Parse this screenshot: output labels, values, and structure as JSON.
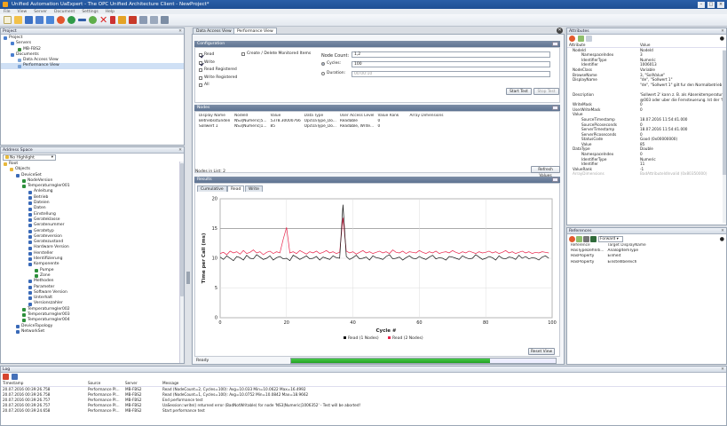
{
  "window": {
    "title": "Unified Automation UaExpert - The OPC Unified Architecture Client - NewProject*"
  },
  "menu": [
    "File",
    "View",
    "Server",
    "Document",
    "Settings",
    "Help"
  ],
  "project": {
    "header": "Project",
    "items": [
      {
        "label": "Project",
        "level": 0
      },
      {
        "label": "Servers",
        "level": 1
      },
      {
        "label": "MB-FBS2",
        "level": 2
      },
      {
        "label": "Documents",
        "level": 1
      },
      {
        "label": "Data Access View",
        "level": 2
      },
      {
        "label": "Performance View",
        "level": 2
      }
    ]
  },
  "address_space": {
    "header": "Address Space",
    "filter": "No Highlight",
    "items": [
      {
        "label": "Root",
        "level": 0
      },
      {
        "label": "Objects",
        "level": 1
      },
      {
        "label": "DeviceSet",
        "level": 2
      },
      {
        "label": "NodeVersion",
        "level": 3
      },
      {
        "label": "Temperaturregler001",
        "level": 3
      },
      {
        "label": "Anleitung",
        "level": 4
      },
      {
        "label": "Betrieb",
        "level": 4
      },
      {
        "label": "Dateien",
        "level": 4
      },
      {
        "label": "Daten",
        "level": 4
      },
      {
        "label": "Einstellung",
        "level": 4
      },
      {
        "label": "Gerateklasse",
        "level": 4
      },
      {
        "label": "Geratenummer",
        "level": 4
      },
      {
        "label": "Geratetyp",
        "level": 4
      },
      {
        "label": "Gerateversion",
        "level": 4
      },
      {
        "label": "Geratezustand",
        "level": 4
      },
      {
        "label": "Hardware Version",
        "level": 4
      },
      {
        "label": "Hersteller",
        "level": 4
      },
      {
        "label": "Identifizierung",
        "level": 4
      },
      {
        "label": "Komponente",
        "level": 4
      },
      {
        "label": "Pumpe",
        "level": 5
      },
      {
        "label": "Zone",
        "level": 5
      },
      {
        "label": "Methoden",
        "level": 4
      },
      {
        "label": "Parameter",
        "level": 4
      },
      {
        "label": "Software Version",
        "level": 4
      },
      {
        "label": "Unterhalt",
        "level": 4
      },
      {
        "label": "Versionszahler",
        "level": 4
      },
      {
        "label": "Temperaturregler002",
        "level": 3
      },
      {
        "label": "Temperaturregler003",
        "level": 3
      },
      {
        "label": "Temperaturregler004",
        "level": 3
      },
      {
        "label": "DeviceTopology",
        "level": 2
      },
      {
        "label": "NetworkSet",
        "level": 2
      }
    ]
  },
  "tabs": [
    "Data Access View",
    "Performance View"
  ],
  "configuration": {
    "title": "Configuration",
    "options": [
      {
        "label": "Read",
        "checked": true
      },
      {
        "label": "Write",
        "checked": true
      },
      {
        "label": "Read Registered",
        "checked": false
      },
      {
        "label": "Write Registered",
        "checked": false
      },
      {
        "label": "All",
        "checked": false
      }
    ],
    "create_delete_label": "Create / Delete Monitored Items",
    "node_count_label": "Node Count:",
    "node_count_value": "1,2",
    "cycles_label": "Cycles:",
    "cycles_value": "100",
    "duration_label": "Duration:",
    "duration_value": "00:00:10",
    "start_label": "Start Test",
    "stop_label": "Stop Test"
  },
  "nodes": {
    "title": "Nodes",
    "columns": [
      "Display Name",
      "NodeId",
      "Value",
      "Data Type",
      "User Access Level",
      "Value Rank",
      "Array Dimensions"
    ],
    "rows": [
      [
        "Betriebsstunden",
        "NS3|Numeric|5...",
        "5378.30000766",
        "OpcUaType_Do...",
        "Readable",
        "0",
        ""
      ],
      [
        "Sollwert 1",
        "NS3|Numeric|1...",
        "85",
        "OpcUaType_Do...",
        "Readable, Write...",
        "0",
        ""
      ]
    ],
    "nodes_in_list": "Nodes in List: 2",
    "refresh_label": "Refresh Values"
  },
  "results": {
    "title": "Results",
    "tabs": [
      "Cumulative",
      "Read",
      "Write"
    ],
    "reset_label": "Reset View",
    "status": "Ready",
    "progress": 1.0
  },
  "chart_data": {
    "type": "line",
    "xlabel": "Cycle #",
    "ylabel": "Time per Call (ms)",
    "xlim": [
      0,
      100
    ],
    "ylim": [
      0,
      20
    ],
    "xticks": [
      0,
      20,
      40,
      60,
      80,
      100
    ],
    "yticks": [
      0,
      5,
      10,
      15,
      20
    ],
    "grid": true,
    "legend": "bottom-center",
    "series": [
      {
        "name": "Read (1 Nodes)",
        "color": "#111111",
        "values": [
          10.2,
          9.8,
          10.4,
          10.0,
          9.6,
          10.3,
          10.1,
          9.7,
          10.5,
          10.0,
          9.9,
          10.6,
          10.2,
          9.8,
          10.0,
          10.4,
          9.7,
          10.1,
          10.3,
          9.9,
          10.0,
          9.6,
          10.5,
          10.2,
          9.8,
          10.1,
          10.4,
          9.9,
          10.0,
          10.3,
          9.7,
          10.2,
          10.0,
          9.8,
          10.4,
          10.1,
          10.0,
          19.0,
          10.3,
          9.8,
          10.1,
          10.5,
          9.9,
          10.0,
          10.2,
          9.7,
          10.4,
          10.1,
          10.0,
          9.8,
          10.3,
          10.6,
          9.9,
          10.0,
          10.2,
          9.7,
          10.1,
          10.4,
          10.0,
          9.9,
          10.3,
          10.0,
          9.8,
          10.2,
          10.5,
          9.9,
          10.1,
          10.0,
          9.7,
          10.3,
          10.2,
          10.0,
          9.8,
          10.4,
          10.1,
          9.9,
          10.0,
          10.6,
          10.2,
          9.8,
          10.0,
          10.3,
          10.1,
          9.7,
          10.4,
          10.0,
          9.9,
          10.2,
          10.1,
          9.8,
          10.5,
          10.0,
          10.3,
          9.9,
          10.1,
          10.0,
          9.7,
          10.2,
          10.4,
          10.0
        ]
      },
      {
        "name": "Read (2 Nodes)",
        "color": "#e8234a",
        "values": [
          10.8,
          11.0,
          10.6,
          11.2,
          10.9,
          11.1,
          10.7,
          11.3,
          10.8,
          11.0,
          11.4,
          10.9,
          11.1,
          10.6,
          11.0,
          11.2,
          10.8,
          11.1,
          10.9,
          13.2,
          15.2,
          10.9,
          11.1,
          10.8,
          11.3,
          11.0,
          10.7,
          11.1,
          10.9,
          11.2,
          10.8,
          11.0,
          11.3,
          10.9,
          11.1,
          10.8,
          11.0,
          16.8,
          11.2,
          10.9,
          11.1,
          10.7,
          11.0,
          11.3,
          10.9,
          11.1,
          10.8,
          11.0,
          11.2,
          10.9,
          11.1,
          10.8,
          11.4,
          11.0,
          10.9,
          11.2,
          10.8,
          11.1,
          11.0,
          10.9,
          11.3,
          11.0,
          10.8,
          11.1,
          10.9,
          11.2,
          10.8,
          11.0,
          11.1,
          10.9,
          11.3,
          11.0,
          10.8,
          11.1,
          10.9,
          11.2,
          11.0,
          10.8,
          11.1,
          10.9,
          11.0,
          11.2,
          10.9,
          11.1,
          10.8,
          11.0,
          11.3,
          10.9,
          11.1,
          10.8,
          11.0,
          11.2,
          10.9,
          11.1,
          10.8,
          11.0,
          10.9,
          11.1,
          11.0,
          10.9
        ]
      }
    ]
  },
  "attributes": {
    "header": "Attributes",
    "col_attr": "Attribute",
    "col_value": "Value",
    "rows": [
      {
        "n": "NodeId",
        "v": "NodeId",
        "lvl": 0
      },
      {
        "n": "NamespaceIndex",
        "v": "3",
        "lvl": 1
      },
      {
        "n": "IdentifierType",
        "v": "Numeric",
        "lvl": 1
      },
      {
        "n": "Identifier",
        "v": "1006013",
        "lvl": 1
      },
      {
        "n": "NodeClass",
        "v": "Variable",
        "lvl": 0
      },
      {
        "n": "BrowseName",
        "v": "3, \"SollValue\"",
        "lvl": 0
      },
      {
        "n": "DisplayName",
        "v": "\"de\", \"Sollwert 1\"",
        "lvl": 0
      },
      {
        "n": "",
        "v": "\"de\", \"Sollwert 1\" gilt fur den Normalbetrieb",
        "lvl": 0
      },
      {
        "n": "",
        "v": "",
        "lvl": 0
      },
      {
        "n": "Description",
        "v": "'Sollwert 2' kann z. B. als Absenktemperatur",
        "lvl": 0
      },
      {
        "n": "",
        "v": "@003 oder uber die Fernsteuerung. Ist der 'Sollwert 2'",
        "lvl": 0
      },
      {
        "n": "WriteMask",
        "v": "0",
        "lvl": 0
      },
      {
        "n": "UserWriteMask",
        "v": "0",
        "lvl": 0
      },
      {
        "n": "Value",
        "v": "",
        "lvl": 0
      },
      {
        "n": "SourceTimestamp",
        "v": "18.07.2016 11:54:41.000",
        "lvl": 1
      },
      {
        "n": "SourcePicoseconds",
        "v": "0",
        "lvl": 1
      },
      {
        "n": "ServerTimestamp",
        "v": "18.07.2016 11:54:41.000",
        "lvl": 1
      },
      {
        "n": "ServerPicoseconds",
        "v": "0",
        "lvl": 1
      },
      {
        "n": "StatusCode",
        "v": "Good (0x00000000)",
        "lvl": 1
      },
      {
        "n": "Value",
        "v": "85",
        "lvl": 1
      },
      {
        "n": "DataType",
        "v": "Double",
        "lvl": 0
      },
      {
        "n": "NamespaceIndex",
        "v": "0",
        "lvl": 1
      },
      {
        "n": "IdentifierType",
        "v": "Numeric",
        "lvl": 1
      },
      {
        "n": "Identifier",
        "v": "11",
        "lvl": 1
      },
      {
        "n": "ValueRank",
        "v": "-1",
        "lvl": 0
      },
      {
        "n": "ArrayDimensions",
        "v": "BadAttributeIdInvalid (0x80350000)",
        "lvl": 0
      }
    ]
  },
  "references": {
    "header": "References",
    "direction": "Forward",
    "columns": [
      "Reference",
      "Target DisplayName"
    ],
    "rows": [
      [
        "HasTypeDefiniti...",
        "AnalogItemType"
      ],
      [
        "HasProperty",
        "Einheit"
      ],
      [
        "HasProperty",
        "EinstellIbereich"
      ]
    ]
  },
  "log": {
    "header": "Log",
    "columns": [
      "Timestamp",
      "Source",
      "Server",
      "Message"
    ],
    "rows": [
      [
        "20.07.2016 00:39:26.758",
        "Performance Pl...",
        "MB-FBS2",
        "Read (NodeCount=2, Cycles=100): Avg=10.033 Min=10.0622 Max=16.4992"
      ],
      [
        "20.07.2016 00:39:26.758",
        "Performance Pl...",
        "MB-FBS2",
        "Read (NodeCount=1, Cycles=100): Avg=10.0752 Min=10.0842 Max=18.9662"
      ],
      [
        "20.07.2016 00:39:26.757",
        "Performance Pl...",
        "MB-FBS2",
        "End performance test"
      ],
      [
        "20.07.2016 00:39:26.757",
        "Performance Pl...",
        "MB-FBS2",
        "UaSession::write() returned error (BadNotWritable) for node 'NS3|Numeric|1006352' - Test will be aborted!"
      ],
      [
        "20.07.2016 00:39:24.658",
        "Performance Pl...",
        "MB-FBS2",
        "Start performance test"
      ]
    ]
  }
}
